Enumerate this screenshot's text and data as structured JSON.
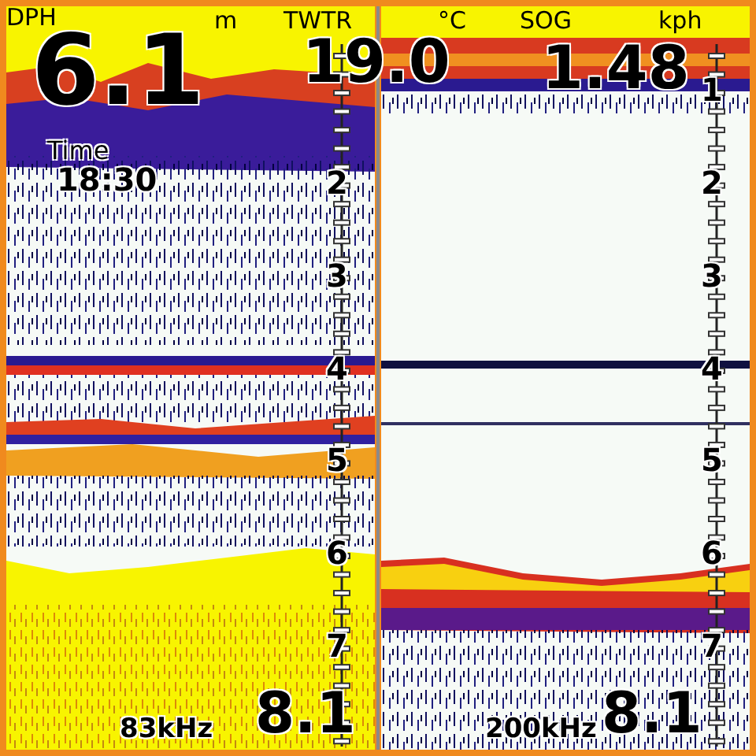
{
  "readings": [
    {
      "label": "DPH",
      "unit": "m",
      "value": "6.1"
    },
    {
      "label": "TWTR",
      "unit": "°C",
      "value": "19.0"
    },
    {
      "label": "SOG",
      "unit": "kph",
      "value": "1.48"
    }
  ],
  "time": {
    "label": "Time",
    "value": "18:30"
  },
  "panels": [
    {
      "kind": "low",
      "frequency": "83kHz",
      "range": "8.1",
      "scale": [
        "2",
        "3",
        "4",
        "5",
        "6",
        "7"
      ]
    },
    {
      "kind": "high",
      "frequency": "200kHz",
      "range": "8.1",
      "scale": [
        "1",
        "2",
        "3",
        "4",
        "5",
        "6",
        "7"
      ]
    }
  ]
}
